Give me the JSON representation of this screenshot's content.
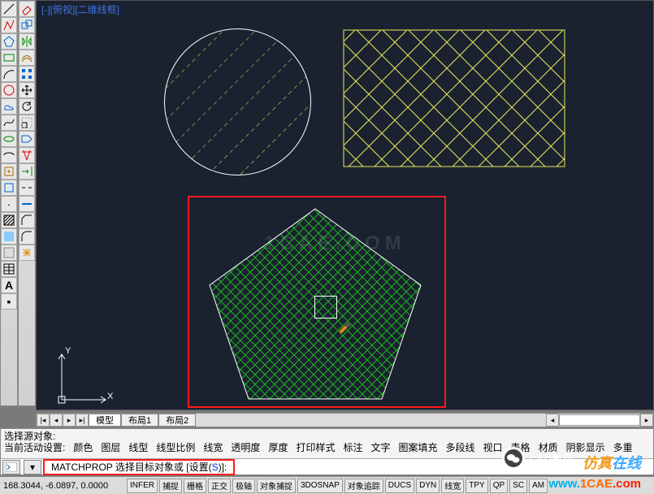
{
  "viewport": {
    "label": "[-][俯视][二维线框]"
  },
  "toolbar_left": {
    "col1": [
      "line",
      "pline",
      "polygon",
      "rect",
      "arc",
      "circle",
      "cloud",
      "spline",
      "ellipse",
      "earc",
      "insert",
      "block",
      "point",
      "hatch",
      "grad",
      "region",
      "table",
      "text"
    ],
    "col2": [
      "move",
      "copy",
      "stretch",
      "rotate",
      "mirror",
      "scale",
      "trim",
      "extend",
      "fillet",
      "cham",
      "array",
      "erase",
      "explode",
      "offset",
      "join",
      "break"
    ]
  },
  "tabs": {
    "model": "模型",
    "layout1": "布局1",
    "layout2": "布局2"
  },
  "watermark_center": "1CAE.COM",
  "ucs": {
    "x": "X",
    "y": "Y"
  },
  "cmd": {
    "line1": "选择源对象:",
    "line2_prefix": "当前活动设置:",
    "settings": [
      "颜色",
      "图层",
      "线型",
      "线型比例",
      "线宽",
      "透明度",
      "厚度",
      "打印样式",
      "标注",
      "文字",
      "图案填充",
      "多段线",
      "视口",
      "表格",
      "材质",
      "阴影显示",
      "多重"
    ],
    "prompt_cmd": "MATCHPROP",
    "prompt_rest": " 选择目标对象或 [设置(",
    "prompt_key": "S",
    "prompt_end": ")]:"
  },
  "status": {
    "coords": "168.3044, -6.0897, 0.0000",
    "buttons": [
      "INFER",
      "捕捉",
      "栅格",
      "正交",
      "极轴",
      "对象捕捉",
      "3DOSNAP",
      "对象追踪",
      "DUCS",
      "DYN",
      "线宽",
      "TPY",
      "QP",
      "SC",
      "AM"
    ]
  },
  "wechat_label": "CAD教程",
  "sim_online": {
    "p1": "仿真",
    "p2": "在线"
  },
  "corner": {
    "p1": "www.",
    "p2": "1CAE",
    "p3": ".com"
  }
}
